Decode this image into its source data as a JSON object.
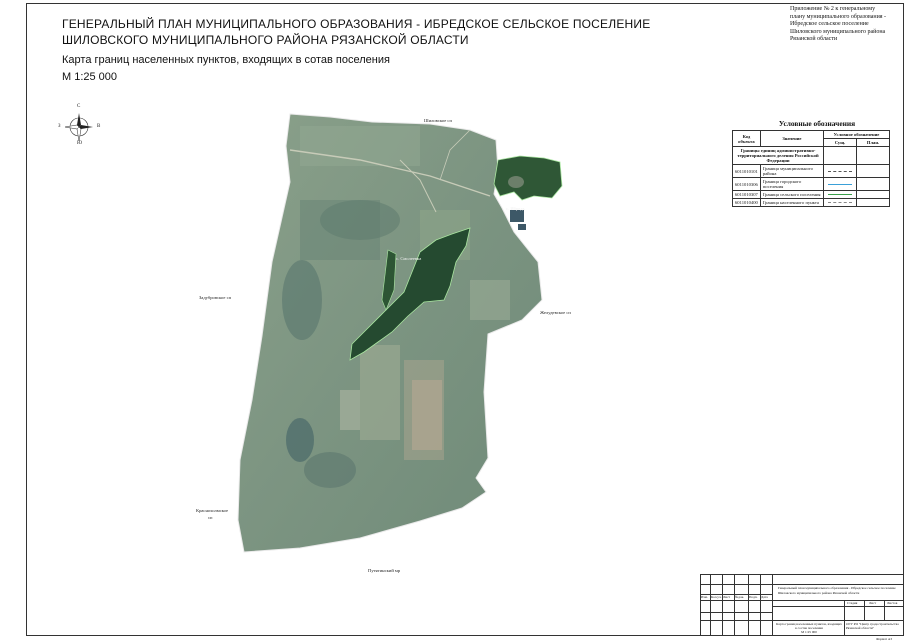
{
  "header": {
    "title_line1": "ГЕНЕРАЛЬНЫЙ ПЛАН МУНИЦИПАЛЬНОГО ОБРАЗОВАНИЯ - ИБРЕДСКОЕ СЕЛЬСКОЕ ПОСЕЛЕНИЕ",
    "title_line2": "ШИЛОВСКОГО МУНИЦИПАЛЬНОГО РАЙОНА РЯЗАНСКОЙ ОБЛАСТИ",
    "subtitle": "Карта границ населенных пунктов, входящих в сотав поселения",
    "scale": "М 1:25 000"
  },
  "appendix": {
    "lines": [
      "Приложение № 2 к генеральному",
      "плану муниципального образования -",
      "Ибредское сельское поселение",
      "Шиловского муниципального района",
      "Рязанской области"
    ]
  },
  "compass": {
    "n": "С",
    "s": "Ю",
    "w": "З",
    "e": "В"
  },
  "map_labels": {
    "north": "Шиловское сп",
    "west": "Задубровское сп",
    "east": "Желудевское сп",
    "south": "Путятинский мр",
    "southwest": "Краснохолмское",
    "southwest2": "сп",
    "village1": "с. Ибредь",
    "village2": "с. Смолеевка"
  },
  "legend": {
    "title": "Условные обозначения",
    "col_code": "Код объекта",
    "col_meaning": "Значение",
    "col_symbol": "Условное обозначение",
    "col_exist": "Сущ.",
    "col_plan": "План.",
    "section": "Границы единиц административно-территориального деления Российской Федерации",
    "rows": [
      {
        "code": "6011010101",
        "label": "Граница муниципального района",
        "color": "#555555"
      },
      {
        "code": "6011010306",
        "label": "Граница городского поселения",
        "color": "#3aa0d8"
      },
      {
        "code": "6011010307",
        "label": "Граница сельского поселения",
        "color": "#3aa04a"
      },
      {
        "code": "6011010400",
        "label": "Граница населенного пункта",
        "color": "#888888"
      }
    ]
  },
  "stamp": {
    "text1": "Генеральный план муниципального образования - Ибредское сельское поселение",
    "text2": "Шиловского муниципального района Рязанской области",
    "cols": [
      "Изм.",
      "Кол.уч.",
      "Лист",
      "№док.",
      "Подп.",
      "Дата"
    ],
    "stage": "Стадия",
    "sheet": "Лист",
    "sheets": "Листов",
    "map_name": "Карта границ населенных пунктов, входящих в состав поселения",
    "map_scale": "М 1:25 000",
    "org": "ОГУ РО \"Центр градостроительства Рязанской области\"",
    "format": "Формат А3"
  }
}
